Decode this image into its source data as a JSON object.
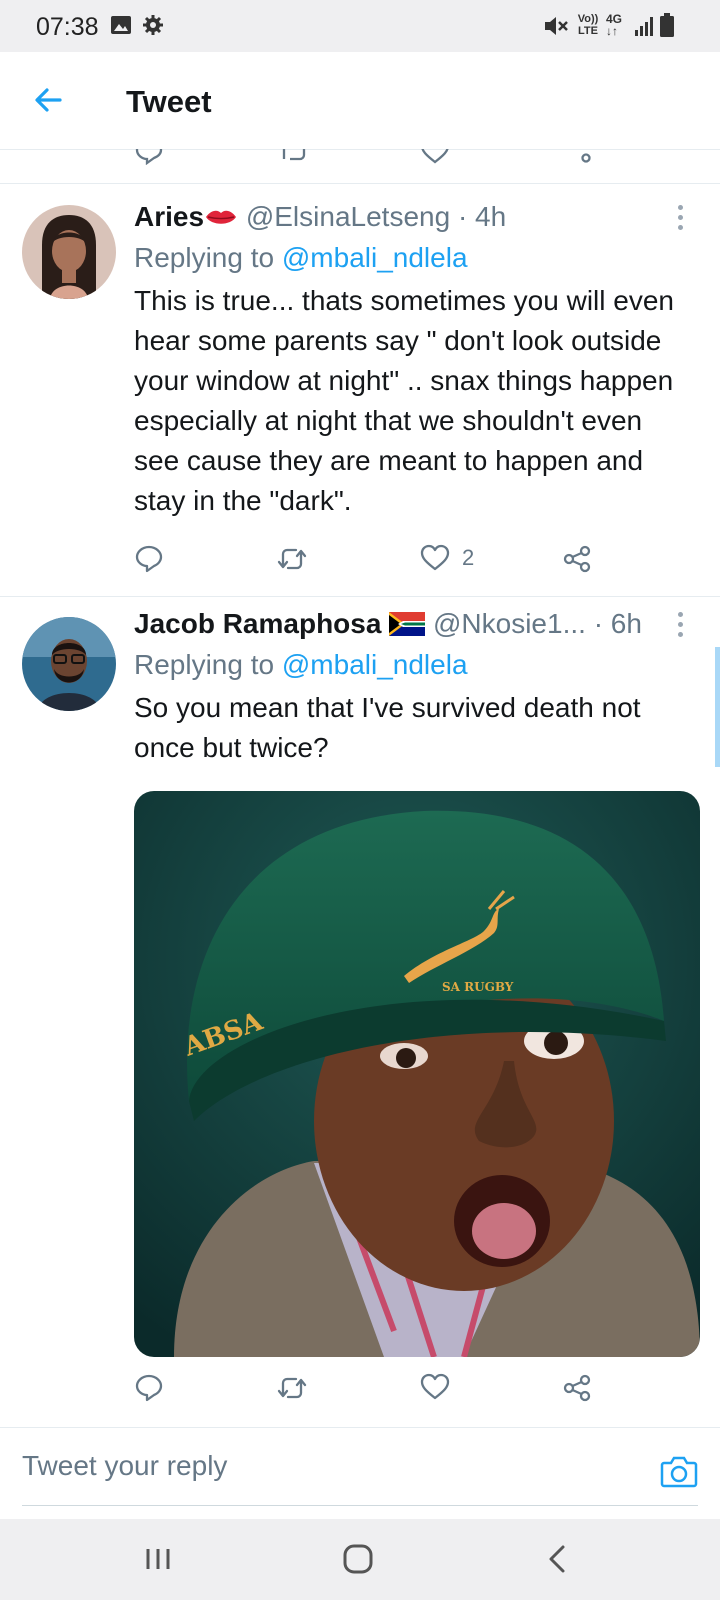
{
  "status_bar": {
    "time": "07:38",
    "left_icons": [
      "image-icon",
      "gear-icon"
    ],
    "right_icons": [
      "mute-icon",
      "volte-icon",
      "4g-icon",
      "signal-icon",
      "battery-icon"
    ],
    "volte_label": "Vo)) LTE",
    "network_label": "4G"
  },
  "app_bar": {
    "title": "Tweet",
    "back_icon": "arrow-left-icon"
  },
  "tweets": [
    {
      "name": "Aries",
      "name_emoji": "lips-emoji",
      "handle": "@ElsinaLetseng",
      "separator": "·",
      "time": "4h",
      "replying_label": "Replying to",
      "mention": "@mbali_ndlela",
      "text": "This is true... thats sometimes you will even hear some parents say \" don't look outside your window at night\" .. snax things happen especially at night that we shouldn't even see cause they are meant to happen and stay in the \"dark\".",
      "like_count": "2"
    },
    {
      "name": "Jacob Ramaphosa",
      "name_emoji": "south-africa-flag",
      "handle": "@Nkosie1...",
      "separator": "·",
      "time": "6h",
      "replying_label": "Replying to",
      "mention": "@mbali_ndlela",
      "text": "So you mean that I've survived death not once but twice?",
      "media": {
        "beanie_text_front": "SA RUGBY",
        "beanie_text_side": "ABSA"
      }
    }
  ],
  "reply_bar": {
    "placeholder": "Tweet your reply",
    "camera_icon": "camera-icon"
  },
  "nav_bar": {
    "icons": [
      "recent-apps-icon",
      "home-icon",
      "back-icon"
    ]
  },
  "colors": {
    "accent": "#1da1f2",
    "muted": "#657786",
    "text": "#14171a",
    "divider": "#e6ecf0",
    "bars": "#efeff1"
  }
}
